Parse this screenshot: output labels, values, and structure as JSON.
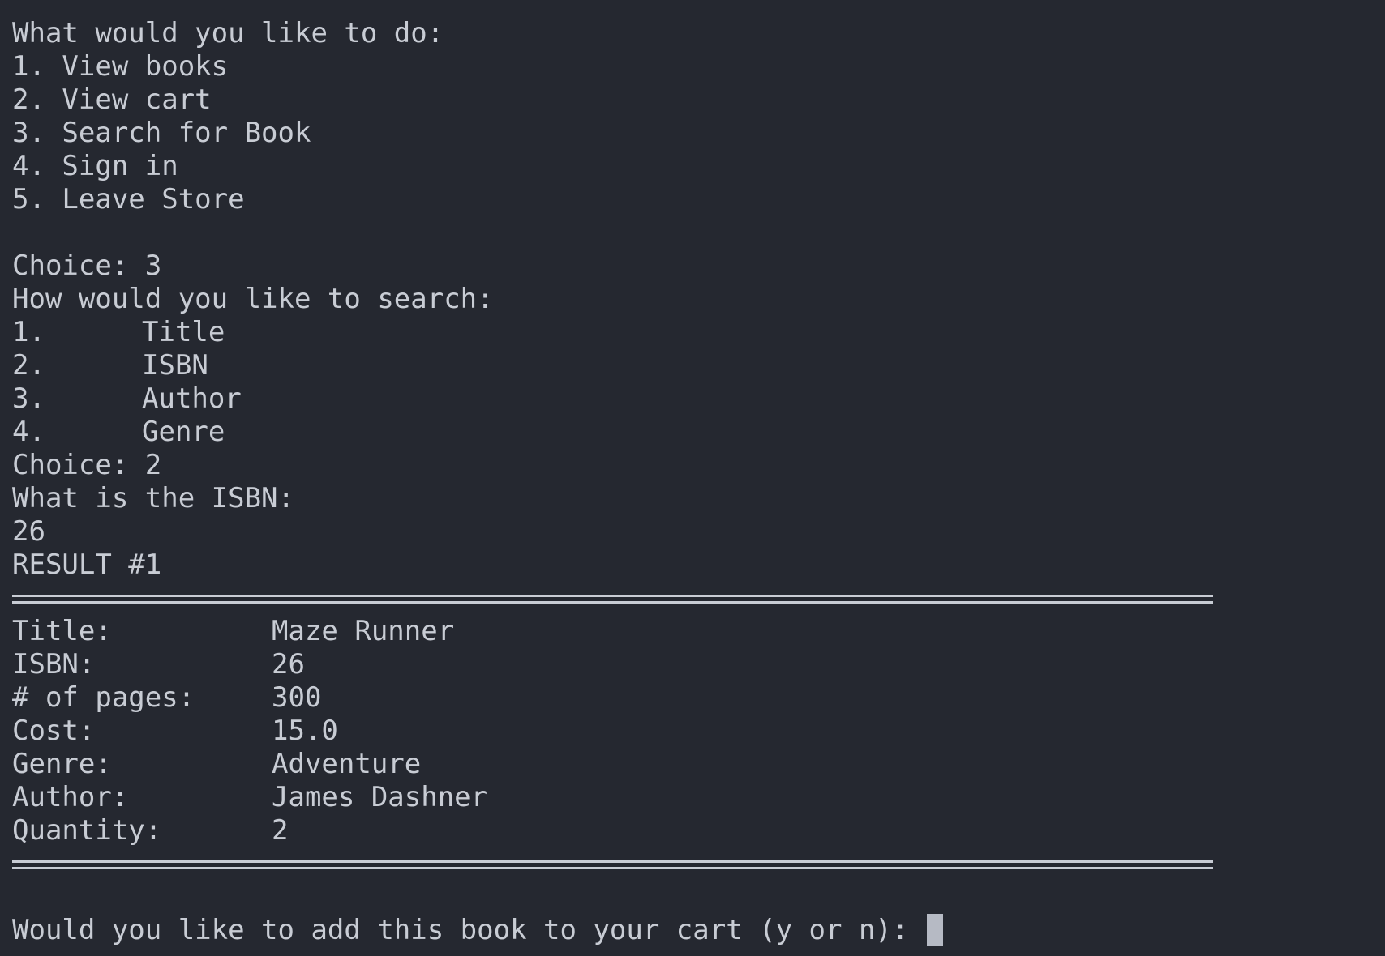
{
  "main_menu": {
    "prompt": "What would you like to do:",
    "options": [
      "1. View books",
      "2. View cart",
      "3. Search for Book",
      "4. Sign in",
      "5. Leave Store"
    ]
  },
  "choice1": "Choice: 3",
  "search_menu": {
    "prompt": "How would you like to search:",
    "options": [
      {
        "num": "1.",
        "label": "Title"
      },
      {
        "num": "2.",
        "label": "ISBN"
      },
      {
        "num": "3.",
        "label": "Author"
      },
      {
        "num": "4.",
        "label": "Genre"
      }
    ]
  },
  "choice2": "Choice: 2",
  "isbn_prompt": "What is the ISBN:",
  "isbn_input": "26",
  "result_header": "RESULT #1",
  "book": {
    "fields": [
      {
        "label": "Title:",
        "value": "Maze Runner"
      },
      {
        "label": "ISBN:",
        "value": "26"
      },
      {
        "label": "# of pages:",
        "value": "300"
      },
      {
        "label": "Cost:",
        "value": "15.0"
      },
      {
        "label": "Genre:",
        "value": "Adventure"
      },
      {
        "label": "Author:",
        "value": "James Dashner"
      },
      {
        "label": "Quantity:",
        "value": "2"
      }
    ]
  },
  "add_prompt": "Would you like to add this book to your cart (y or n): "
}
